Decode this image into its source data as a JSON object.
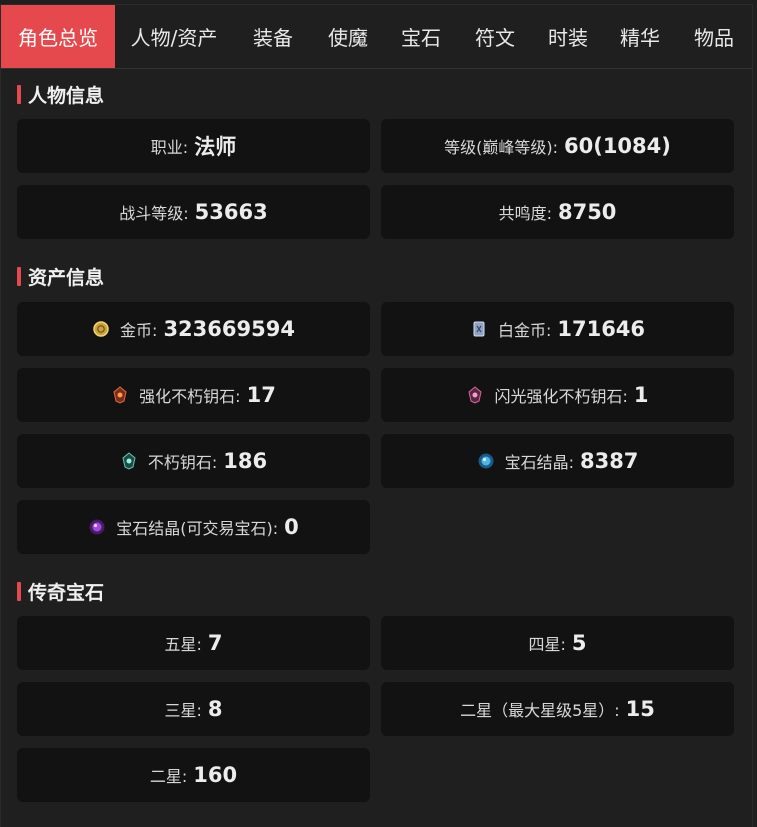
{
  "tabs": [
    "角色总览",
    "人物/资产",
    "装备",
    "使魔",
    "宝石",
    "符文",
    "时装",
    "精华",
    "物品"
  ],
  "sections": {
    "character": "人物信息",
    "assets": "资产信息",
    "legendary": "传奇宝石"
  },
  "character": {
    "class_label": "职业:",
    "class_value": "法师",
    "level_label": "等级(巅峰等级):",
    "level_value": "60(1084)",
    "combat_label": "战斗等级:",
    "combat_value": "53663",
    "resonance_label": "共鸣度:",
    "resonance_value": "8750"
  },
  "assets": {
    "gold_label": "金币:",
    "gold_value": "323669594",
    "platinum_label": "白金币:",
    "platinum_value": "171646",
    "enh_key_label": "强化不朽钥石:",
    "enh_key_value": "17",
    "flash_key_label": "闪光强化不朽钥石:",
    "flash_key_value": "1",
    "key_label": "不朽钥石:",
    "key_value": "186",
    "crystal_label": "宝石结晶:",
    "crystal_value": "8387",
    "trade_crystal_label": "宝石结晶(可交易宝石):",
    "trade_crystal_value": "0"
  },
  "legendary": {
    "five_label": "五星:",
    "five_value": "7",
    "four_label": "四星:",
    "four_value": "5",
    "three_label": "三星:",
    "three_value": "8",
    "two_max_label": "二星（最大星级5星）:",
    "two_max_value": "15",
    "two_label": "二星:",
    "two_value": "160"
  },
  "colors": {
    "accent": "#e5484d",
    "card": "#121212",
    "background": "#1f1f1f"
  }
}
